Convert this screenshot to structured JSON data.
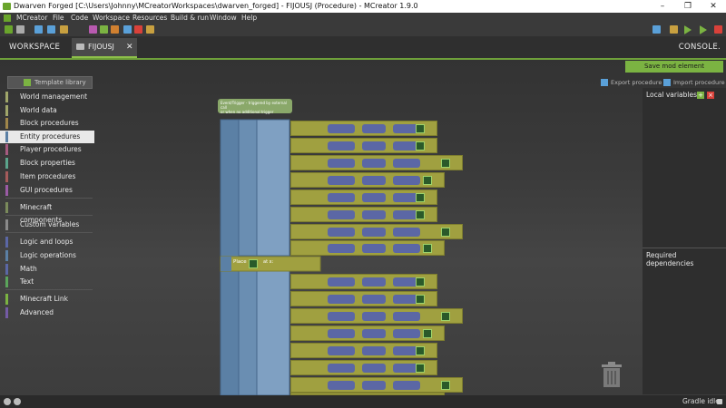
{
  "window": {
    "title": "Dwarven Forged [C:\\Users\\Johnny\\MCreatorWorkspaces\\dwarven_forged] - FIJOUSJ (Procedure) - MCreator 1.9.0",
    "minimize": "–",
    "maximize": "❐",
    "close": "✕"
  },
  "menu": {
    "items": [
      "MCreator",
      "File",
      "Code",
      "Workspace",
      "Resources",
      "Build & run",
      "Window",
      "Help"
    ]
  },
  "tabs": {
    "workspace": "WORKSPACE",
    "procedure": "FIJOUSJ",
    "close": "✕",
    "console": "CONSOLE."
  },
  "editor": {
    "save_label": "Save mod element",
    "template_library": "Template library",
    "export_procedure": "Export procedure",
    "import_procedure": "Import procedure"
  },
  "palette": {
    "items": [
      {
        "label": "World management",
        "color": "#a0a66a"
      },
      {
        "label": "World data",
        "color": "#a0a66a"
      },
      {
        "label": "Block procedures",
        "color": "#a0864a"
      },
      {
        "label": "Entity procedures",
        "color": "#5b80a5"
      },
      {
        "label": "Player procedures",
        "color": "#a55b80"
      },
      {
        "label": "Block properties",
        "color": "#5ba58c"
      },
      {
        "label": "Item procedures",
        "color": "#a55b5b"
      },
      {
        "label": "GUI procedures",
        "color": "#9a5ba5"
      },
      {
        "label": "Minecraft components",
        "color": "#7a8a5b"
      },
      {
        "label": "Custom variables",
        "color": "#8a8a8a"
      },
      {
        "label": "Logic and loops",
        "color": "#5b67a5"
      },
      {
        "label": "Logic operations",
        "color": "#5b80a5"
      },
      {
        "label": "Math",
        "color": "#5b67a5"
      },
      {
        "label": "Text",
        "color": "#5ba55b"
      },
      {
        "label": "Minecraft Link",
        "color": "#7bb342"
      },
      {
        "label": "Advanced",
        "color": "#745ba5"
      }
    ]
  },
  "blocks": {
    "event_line1": "Event/Trigger - triggered by external call",
    "event_line2": "or when no additional trigger",
    "place": "Place",
    "at": "at x:"
  },
  "right_panel": {
    "local_variables": "Local variables",
    "required_dependencies": "Required dependencies"
  },
  "status": {
    "gradle": "Gradle idle"
  },
  "colors": {
    "accent": "#7bb342",
    "block_blue": "#5b80a5",
    "block_olive": "#a0a040"
  }
}
